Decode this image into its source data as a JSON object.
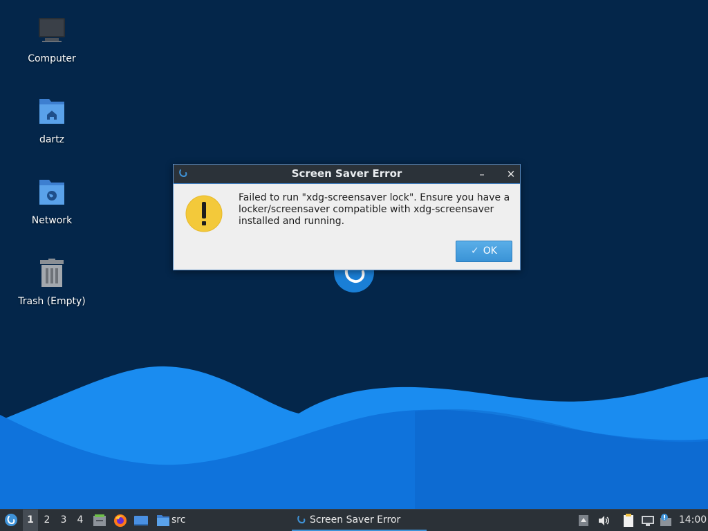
{
  "desktop": {
    "icons": [
      {
        "label": "Computer",
        "icon": "computer-icon"
      },
      {
        "label": "dartz",
        "icon": "home-folder-icon"
      },
      {
        "label": "Network",
        "icon": "network-folder-icon"
      },
      {
        "label": "Trash (Empty)",
        "icon": "trash-icon"
      }
    ]
  },
  "dialog": {
    "title": "Screen Saver Error",
    "message": "Failed to run  \"xdg-screensaver lock\". Ensure you have a locker/screensaver compatible with xdg-screensaver installed and running.",
    "ok_label": "OK",
    "minimize_symbol": "–",
    "close_symbol": "✕"
  },
  "taskbar": {
    "workspaces": [
      "1",
      "2",
      "3",
      "4"
    ],
    "active_workspace": "1",
    "launchers": [
      "file-manager-icon",
      "firefox-icon",
      "show-desktop-icon"
    ],
    "folder_label": "src",
    "task_label": "Screen Saver Error",
    "clock": "14:00"
  },
  "colors": {
    "background": "#04264a",
    "wave_light": "#1b8ff0",
    "wave_dark": "#0b67d0",
    "accent": "#3f93d8",
    "warning": "#f3c93a"
  }
}
